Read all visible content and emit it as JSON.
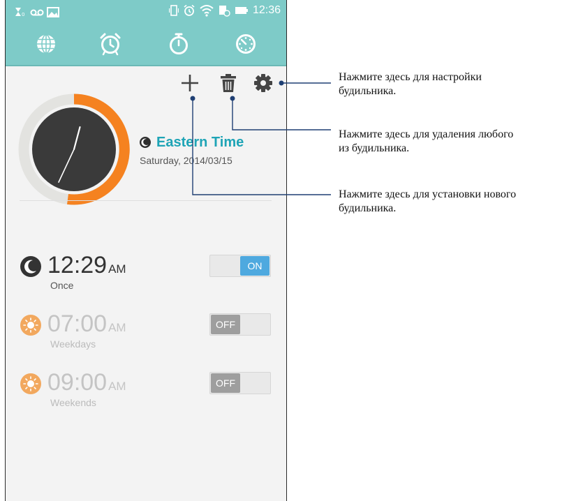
{
  "status_bar": {
    "time": "12:36",
    "left_icons": [
      "sim-icon",
      "voicemail-icon",
      "image-icon"
    ],
    "right_icons": [
      "vibrate-icon",
      "alarm-icon",
      "wifi-icon",
      "battery-icon"
    ]
  },
  "tabs": [
    {
      "icon": "globe-icon"
    },
    {
      "icon": "alarm-clock-icon",
      "selected": true
    },
    {
      "icon": "stopwatch-icon"
    },
    {
      "icon": "timer-icon"
    }
  ],
  "toolbar": {
    "add_icon": "plus-icon",
    "delete_icon": "trash-icon",
    "settings_icon": "gear-icon"
  },
  "world_clock": {
    "timezone_name": "Eastern Time",
    "date": "Saturday, 2014/03/15",
    "hour_hand_degrees": 15,
    "minute_hand_degrees": 205,
    "dial_progress_fraction": 0.52
  },
  "alarms": [
    {
      "time": "12:29",
      "ampm": "AM",
      "repeat": "Once",
      "icon": "moon-icon",
      "state": "ON",
      "enabled": true
    },
    {
      "time": "07:00",
      "ampm": "AM",
      "repeat": "Weekdays",
      "icon": "sun-icon",
      "state": "OFF",
      "enabled": false
    },
    {
      "time": "09:00",
      "ampm": "AM",
      "repeat": "Weekends",
      "icon": "sun-icon",
      "state": "OFF",
      "enabled": false
    }
  ],
  "callouts": [
    {
      "line1": "Нажмите здесь для настройки",
      "line2": "будильника."
    },
    {
      "line1": "Нажмите здесь для удаления любого",
      "line2": "из будильника."
    },
    {
      "line1": "Нажмите здесь для установки нового",
      "line2": "будильника."
    }
  ],
  "colors": {
    "accent_teal": "#7ecbc8",
    "timezone_text": "#1ea4b6",
    "dial_orange": "#f58220",
    "toggle_on": "#4ea9df",
    "toggle_off": "#9e9e9e",
    "sun_icon": "#f2a85e"
  }
}
